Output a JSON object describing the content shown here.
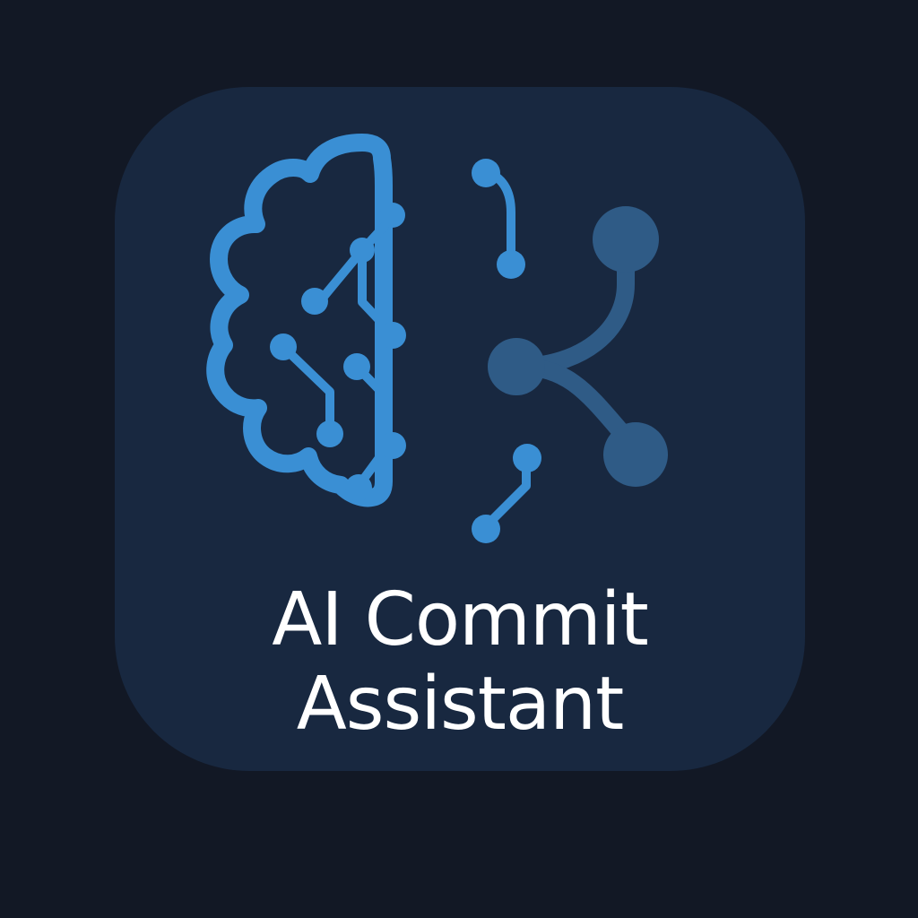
{
  "icon": {
    "name": "brain-circuit-git-icon",
    "title_line1": "AI Commit",
    "title_line2": "Assistant"
  },
  "colors": {
    "page_background": "#121825",
    "icon_background": "#182840",
    "brain_blue": "#3a8fd4",
    "git_graph_blue": "#2f5b86",
    "text": "#ffffff"
  }
}
